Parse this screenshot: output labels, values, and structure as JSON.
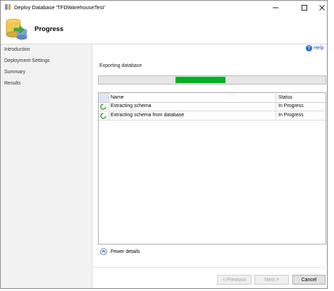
{
  "window": {
    "title": "Deploy Database 'TFDWarehouseTest'"
  },
  "header": {
    "title": "Progress"
  },
  "sidebar": {
    "items": [
      {
        "label": "Introduction"
      },
      {
        "label": "Deployment Settings"
      },
      {
        "label": "Summary"
      },
      {
        "label": "Results"
      }
    ]
  },
  "help": {
    "label": "Help"
  },
  "progress": {
    "label": "Exporting database",
    "fill_start_fraction": 0.34,
    "fill_end_fraction": 0.56,
    "color": "#06b025"
  },
  "grid": {
    "columns": {
      "name": "Name",
      "status": "Status"
    },
    "rows": [
      {
        "name": "Extracting schema",
        "status": "In Progress",
        "icon": "spinner-icon"
      },
      {
        "name": "Extracting schema from database",
        "status": "In Progress",
        "icon": "spinner-icon"
      }
    ]
  },
  "details": {
    "label": "Fewer details"
  },
  "buttons": {
    "previous": "< Previous",
    "next": "Next >",
    "cancel": "Cancel"
  }
}
